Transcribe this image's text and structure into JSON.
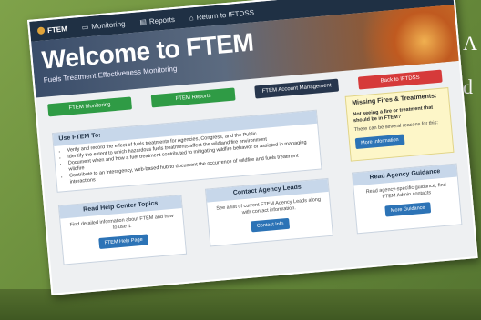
{
  "slide_text": "A\nd",
  "nav": {
    "brand": "FTEM",
    "items": [
      {
        "label": "Monitoring",
        "icon": "monitor-icon"
      },
      {
        "label": "Reports",
        "icon": "report-icon"
      },
      {
        "label": "Return to IFTDSS",
        "icon": "home-icon"
      }
    ]
  },
  "hero": {
    "title": "Welcome to FTEM",
    "subtitle": "Fuels Treatment Effectiveness Monitoring"
  },
  "buttons": {
    "monitoring": "FTEM Monitoring",
    "reports": "FTEM Reports",
    "account": "FTEM Account Management",
    "back": "Back to IFTDSS"
  },
  "use": {
    "header": "Use FTEM To:",
    "items": [
      "Verify and record the effect of fuels treatments for Agencies, Congress, and the Public",
      "Identify the extent to which hazardous fuels treatments affect the wildland fire environment",
      "Document when and how a fuel treatment contributed to mitigating wildfire behavior or assisted in managing wildfire",
      "Contribute to an interagency, web-based hub to document the occurrence of wildfire and fuels treatment interactions"
    ]
  },
  "missing": {
    "title": "Missing Fires & Treatments:",
    "question": "Not seeing a fire or treatment that should be in FTEM?",
    "reasons": "There can be several reasons for this:",
    "button": "More Information"
  },
  "help": {
    "header": "Read Help Center Topics",
    "text": "Find detailed information about FTEM and how to use it.",
    "button": "FTEM Help Page"
  },
  "leads": {
    "header": "Contact Agency Leads",
    "text": "See a list of current FTEM Agency Leads along with contact information.",
    "button": "Contact Info"
  },
  "guidance": {
    "header": "Read Agency Guidance",
    "text": "Read agency-specific guidance, find FTEM Admin contacts",
    "button": "More Guidance"
  },
  "colors": {
    "navbar": "#1f3044",
    "green_button": "#2f9b45",
    "navy_button": "#27364d",
    "red_button": "#d63a3a",
    "blue_button": "#2c73b6",
    "panel_header": "#c7d7ea",
    "notice_bg": "#fdf6c8"
  }
}
